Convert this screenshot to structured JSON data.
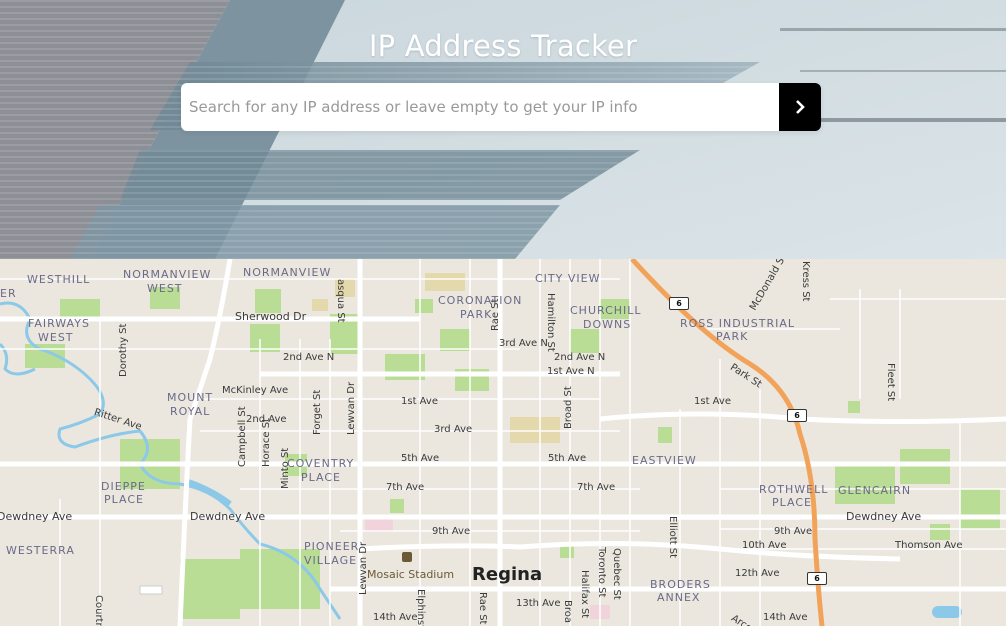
{
  "header": {
    "title": "IP Address Tracker",
    "search_placeholder": "Search for any IP address or leave empty to get your IP info",
    "search_value": "",
    "submit_icon": "chevron-right-icon"
  },
  "map": {
    "city_label": "Regina",
    "poi_label": "Mosaic Stadium",
    "highway_number": "6",
    "neighborhoods": {
      "westhill": "WESTHILL",
      "normanview_west_1": "NORMANVIEW",
      "normanview_west_2": "WEST",
      "normanview": "NORMANVIEW",
      "city_view": "CITY VIEW",
      "coronation_park_1": "CORONATION",
      "coronation_park_2": "PARK",
      "churchill_downs_1": "CHURCHILL",
      "churchill_downs_2": "DOWNS",
      "ross_industrial_park_1": "ROSS INDUSTRIAL",
      "ross_industrial_park_2": "PARK",
      "fairways_west_1": "FAIRWAYS",
      "fairways_west_2": "WEST",
      "mount_royal_1": "MOUNT",
      "mount_royal_2": "ROYAL",
      "coventry_place_1": "COVENTRY",
      "coventry_place_2": "PLACE",
      "eastview": "EASTVIEW",
      "rothwell_place_1": "ROTHWELL",
      "rothwell_place_2": "PLACE",
      "glencairn": "GLENCAIRN",
      "dieppe_place_1": "DIEPPE",
      "dieppe_place_2": "PLACE",
      "westerra": "WESTERRA",
      "pioneer_village_1": "PIONEER",
      "pioneer_village_2": "VILLAGE",
      "broders_annex_1": "BRODERS",
      "broders_annex_2": "ANNEX",
      "er": "ER"
    },
    "streets": {
      "sherwood_dr": "Sherwood Dr",
      "pasqua_st": "asqua St",
      "hamilton_st": "Hamilton St",
      "mcdonald_st": "McDonald St",
      "kress_st": "Kress St",
      "dorothy_st": "Dorothy St",
      "second_ave_n_w": "2nd Ave N",
      "third_ave_n": "3rd Ave N",
      "rae_st_n": "Rae St",
      "second_ave_n_e": "2nd Ave N",
      "first_ave_n": "1st Ave N",
      "park_st": "Park St",
      "fleet_st": "Fleet St",
      "mckinley_ave": "McKinley Ave",
      "ritter_ave": "Ritter Ave",
      "second_ave": "2nd Ave",
      "campbell_st": "Campbell St",
      "horace_st": "Horace St",
      "forget_st": "Forget St",
      "lewvan_dr": "Lewvan Dr",
      "first_ave_w": "1st Ave",
      "third_ave": "3rd Ave",
      "broad_st_n": "Broad St",
      "first_ave_e": "1st Ave",
      "minto_st": "Minto St",
      "fifth_ave_w": "5th Ave",
      "fifth_ave_e": "5th Ave",
      "seventh_ave_w": "7th Ave",
      "seventh_ave_e": "7th Ave",
      "dewdney_ave_w": "Dewdney Ave",
      "dewdney_ave_c": "Dewdney Ave",
      "dewdney_ave_e": "Dewdney Ave",
      "ninth_ave_w": "9th Ave",
      "ninth_ave_e": "9th Ave",
      "elliott_st": "Elliott St",
      "tenth_ave": "10th Ave",
      "thomson_ave": "Thomson Ave",
      "twelfth_ave": "12th Ave",
      "quebec_st": "Quebec St",
      "toronto_st": "Toronto St",
      "halifax_st": "Halifax St",
      "thirteenth_ave": "13th Ave",
      "fourteenth_ave_w": "14th Ave",
      "fourteenth_ave_e": "14th Ave",
      "elphinstone": "Elphinst",
      "rae_st_s": "Rae St",
      "broad_s": "Broa",
      "arcola": "Arco",
      "courtney": "Courtn",
      "lewvan_s": "Lewvan Dr"
    }
  }
}
